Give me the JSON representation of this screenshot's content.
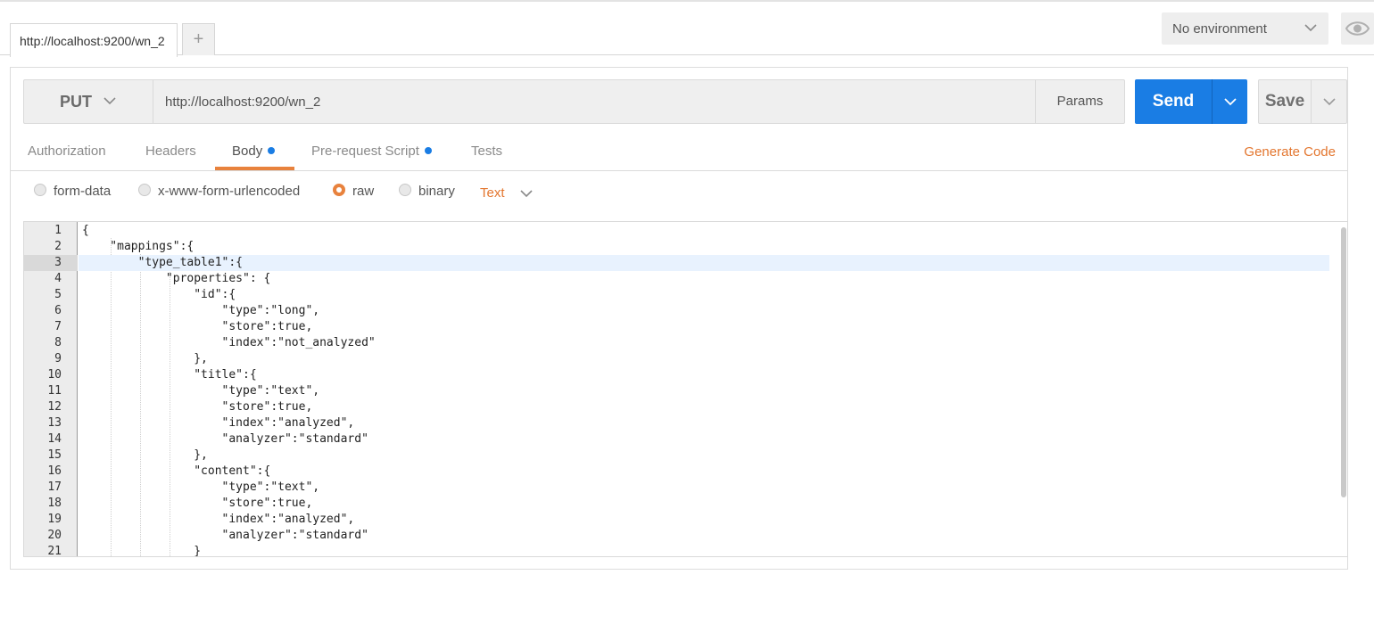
{
  "tabs": {
    "active_tab_label": "http://localhost:9200/wn_2",
    "add_tab_label": "+"
  },
  "environment": {
    "selected": "No environment"
  },
  "request": {
    "method": "PUT",
    "url": "http://localhost:9200/wn_2",
    "params_label": "Params",
    "send_label": "Send",
    "save_label": "Save"
  },
  "subtabs": {
    "authorization": "Authorization",
    "headers": "Headers",
    "body": "Body",
    "prerequest": "Pre-request Script",
    "tests": "Tests",
    "generate_code": "Generate Code"
  },
  "body_types": {
    "form_data": "form-data",
    "urlencoded": "x-www-form-urlencoded",
    "raw": "raw",
    "binary": "binary",
    "raw_format": "Text"
  },
  "editor": {
    "active_line": 3,
    "lines": [
      "{",
      "    \"mappings\":{",
      "        \"type_table1\":{",
      "            \"properties\": {",
      "                \"id\":{",
      "                    \"type\":\"long\",",
      "                    \"store\":true,",
      "                    \"index\":\"not_analyzed\"",
      "                },",
      "                \"title\":{",
      "                    \"type\":\"text\",",
      "                    \"store\":true,",
      "                    \"index\":\"analyzed\",",
      "                    \"analyzer\":\"standard\"",
      "                },",
      "                \"content\":{",
      "                    \"type\":\"text\",",
      "                    \"store\":true,",
      "                    \"index\":\"analyzed\",",
      "                    \"analyzer\":\"standard\"",
      "                }"
    ]
  },
  "colors": {
    "accent_orange": "#e8823d",
    "send_blue": "#1a7de4"
  }
}
